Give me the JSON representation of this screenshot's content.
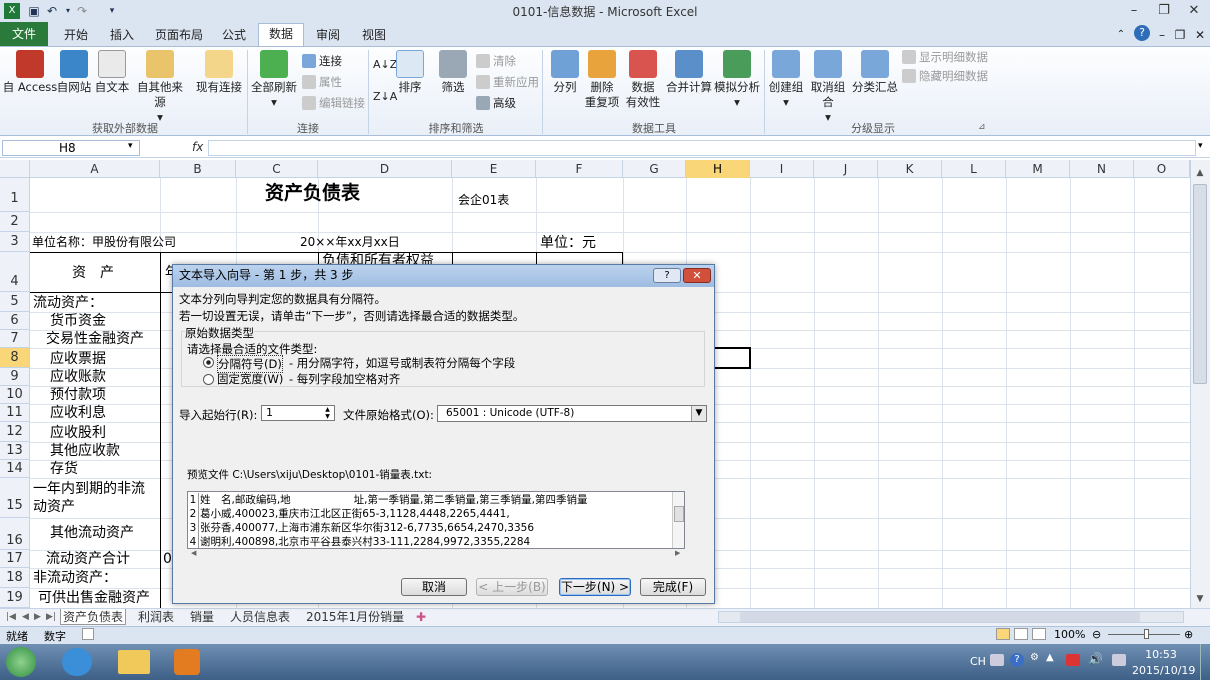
{
  "window": {
    "title": "0101-信息数据 - Microsoft Excel"
  },
  "ribbon": {
    "file": "文件",
    "tabs": [
      "开始",
      "插入",
      "页面布局",
      "公式",
      "数据",
      "审阅",
      "视图"
    ],
    "external": {
      "access": "自 Access",
      "web": "自网站",
      "text": "自文本",
      "other": "自其他来源",
      "existing": "现有连接",
      "label": "获取外部数据"
    },
    "connections": {
      "refresh": "全部刷新",
      "conn": "连接",
      "props": "属性",
      "edit": "编辑链接",
      "label": "连接"
    },
    "sortfilter": {
      "sort": "排序",
      "filter": "筛选",
      "clear": "清除",
      "reapply": "重新应用",
      "advanced": "高级",
      "label": "排序和筛选"
    },
    "tools": {
      "split": "分列",
      "dedupe": "删除\n重复项",
      "valid": "数据\n有效性",
      "consolidate": "合并计算",
      "whatif": "模拟分析",
      "label": "数据工具"
    },
    "outline": {
      "group": "创建组",
      "ungroup": "取消组合",
      "subtotal": "分类汇总",
      "show": "显示明细数据",
      "hide": "隐藏明细数据",
      "label": "分级显示"
    }
  },
  "formula_bar": {
    "name_box": "H8",
    "fx": "fx",
    "formula": ""
  },
  "columns": [
    "A",
    "B",
    "C",
    "D",
    "E",
    "F",
    "G",
    "H",
    "I",
    "J",
    "K",
    "L",
    "M",
    "N",
    "O"
  ],
  "rows": [
    "1",
    "2",
    "3",
    "4",
    "5",
    "6",
    "7",
    "8",
    "9",
    "10",
    "11",
    "12",
    "13",
    "14",
    "15",
    "16",
    "17",
    "18",
    "19"
  ],
  "cells": {
    "title": "资产负债表",
    "form_no": "会企01表",
    "company": "单位名称：甲股份有限公司",
    "date": "20××年xx月xx日",
    "unit": "单位：元",
    "asset_hdr": "资　产",
    "b4": "年",
    "liab_hdr": "负债和所有者权益",
    "a5": "流动资产：",
    "a6": "货币资金",
    "a7": "交易性金融资产",
    "a8": "应收票据",
    "a9": "应收账款",
    "a10": "预付款项",
    "a11": "应收利息",
    "a12": "应收股利",
    "a13": "其他应收款",
    "a14": "存货",
    "a15": "一年内到期的非流动资产",
    "a16": "其他流动资产",
    "a17": "流动资产合计",
    "b17": "0",
    "a18": "非流动资产：",
    "a19": "可供出售金融资产"
  },
  "sheets": [
    "资产负债表",
    "利润表",
    "销量",
    "人员信息表",
    "2015年1月份销量"
  ],
  "status": {
    "ready": "就绪",
    "mode": "数字",
    "zoom": "100%"
  },
  "taskbar": {
    "lang": "CH",
    "time": "10:53",
    "date": "2015/10/19"
  },
  "dialog": {
    "title": "文本导入向导 - 第 1 步，共 3 步",
    "line1": "文本分列向导判定您的数据具有分隔符。",
    "line2": "若一切设置无误，请单击“下一步”，否则请选择最合适的数据类型。",
    "group": "原始数据类型",
    "prompt": "请选择最合适的文件类型:",
    "opt1": "分隔符号(D)",
    "opt1_desc": "- 用分隔字符，如逗号或制表符分隔每个字段",
    "opt2": "固定宽度(W)",
    "opt2_desc": "- 每列字段加空格对齐",
    "start_label": "导入起始行(R):",
    "start_value": "1",
    "origin_label": "文件原始格式(O):",
    "origin_value": "65001 : Unicode (UTF-8)",
    "preview_label": "预览文件 C:\\Users\\xiju\\Desktop\\0101-销量表.txt:",
    "preview": [
      {
        "n": "1",
        "t": "姓　名,邮政编码,地　　　　　　址,第一季销量,第二季销量,第三季销量,第四季销量"
      },
      {
        "n": "2",
        "t": "葛小威,400023,重庆市江北区正街65-3,1128,4448,2265,4441,"
      },
      {
        "n": "3",
        "t": "张芬香,400077,上海市浦东新区华尔街312-6,7735,6654,2470,3356"
      },
      {
        "n": "4",
        "t": "谢明利,400898,北京市平谷县泰兴村33-111,2284,9972,3355,2284"
      }
    ],
    "cancel": "取消",
    "back": "< 上一步(B)",
    "next": "下一步(N) >",
    "finish": "完成(F)"
  }
}
